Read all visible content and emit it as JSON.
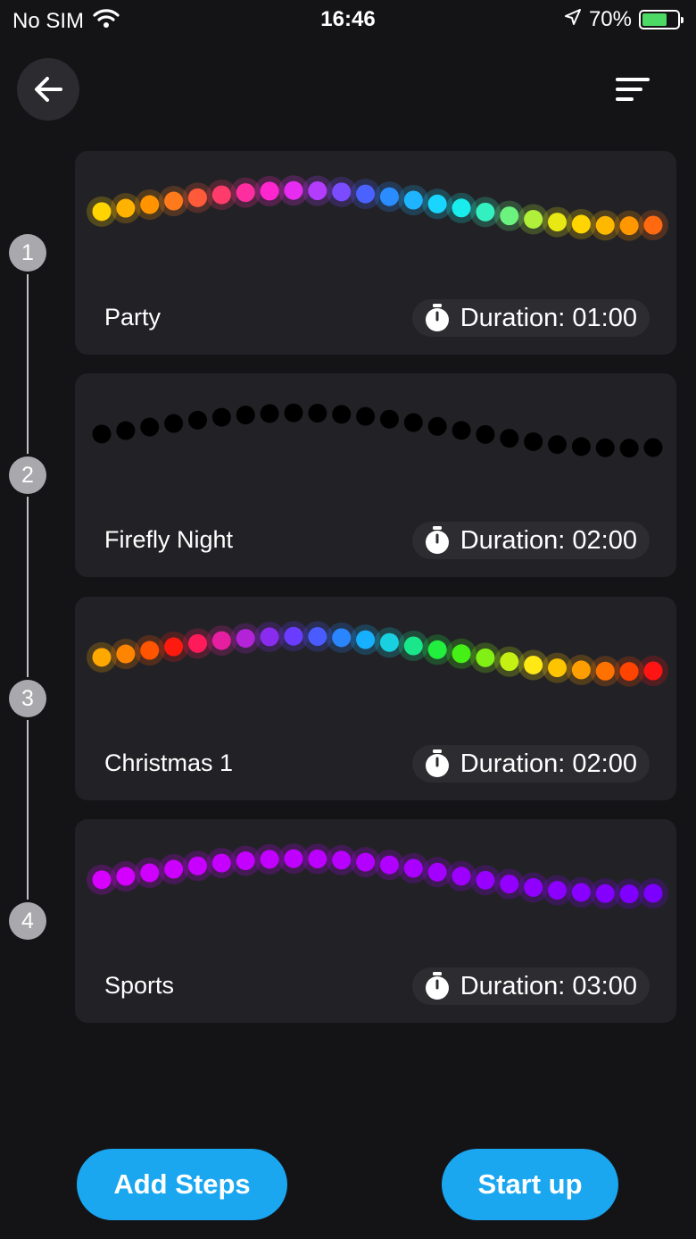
{
  "status": {
    "carrier": "No SIM",
    "time": "16:46",
    "battery_text": "70%",
    "battery_level": 0.7
  },
  "header": {
    "back_icon": "arrow-left-icon",
    "menu_icon": "sort-lines-icon"
  },
  "steps": [
    {
      "number": "1",
      "name": "Party",
      "duration": "Duration: 01:00",
      "colors": [
        "#ffd400",
        "#ffb300",
        "#ff9400",
        "#ff7a1a",
        "#ff5a3a",
        "#ff3b6b",
        "#ff2ea0",
        "#ff26d0",
        "#e62cf0",
        "#b33cff",
        "#7a4bff",
        "#4a62ff",
        "#2a8cff",
        "#1fb4ff",
        "#19d6ff",
        "#18ecec",
        "#32f0c0",
        "#6cf27e",
        "#b0f03a",
        "#e8e814",
        "#ffd400",
        "#ffb800",
        "#ff9800",
        "#ff6a10"
      ]
    },
    {
      "number": "2",
      "name": "Firefly Night",
      "duration": "Duration: 02:00",
      "colors": [
        "#000000",
        "#000000",
        "#000000",
        "#000000",
        "#000000",
        "#000000",
        "#000000",
        "#000000",
        "#000000",
        "#000000",
        "#000000",
        "#000000",
        "#000000",
        "#000000",
        "#000000",
        "#000000",
        "#000000",
        "#000000",
        "#000000",
        "#000000",
        "#000000",
        "#000000",
        "#000000",
        "#000000"
      ]
    },
    {
      "number": "3",
      "name": "Christmas 1",
      "duration": "Duration: 02:00",
      "colors": [
        "#ffa800",
        "#ff8400",
        "#ff5500",
        "#ff1a10",
        "#ff1a5a",
        "#e61ea0",
        "#b324d8",
        "#8a2cf0",
        "#6a3cff",
        "#4a5cff",
        "#2a86ff",
        "#16b0ff",
        "#18d0e0",
        "#1ae68a",
        "#22ee40",
        "#44f016",
        "#82f014",
        "#c4f014",
        "#ffe814",
        "#ffc400",
        "#ff9e00",
        "#ff7200",
        "#ff4400",
        "#ff1414"
      ]
    },
    {
      "number": "4",
      "name": "Sports",
      "duration": "Duration: 03:00",
      "colors": [
        "#d800ff",
        "#d400ff",
        "#d000ff",
        "#cc00ff",
        "#c800ff",
        "#c600ff",
        "#c400ff",
        "#c200ff",
        "#c000ff",
        "#bc00ff",
        "#b800ff",
        "#b400ff",
        "#b000ff",
        "#aa00ff",
        "#a400ff",
        "#9e00ff",
        "#9800ff",
        "#9400ff",
        "#9000ff",
        "#8c00ff",
        "#8800ff",
        "#8400ff",
        "#8000ff",
        "#7c00ff"
      ]
    }
  ],
  "buttons": {
    "add_steps": "Add Steps",
    "start_up": "Start up"
  }
}
